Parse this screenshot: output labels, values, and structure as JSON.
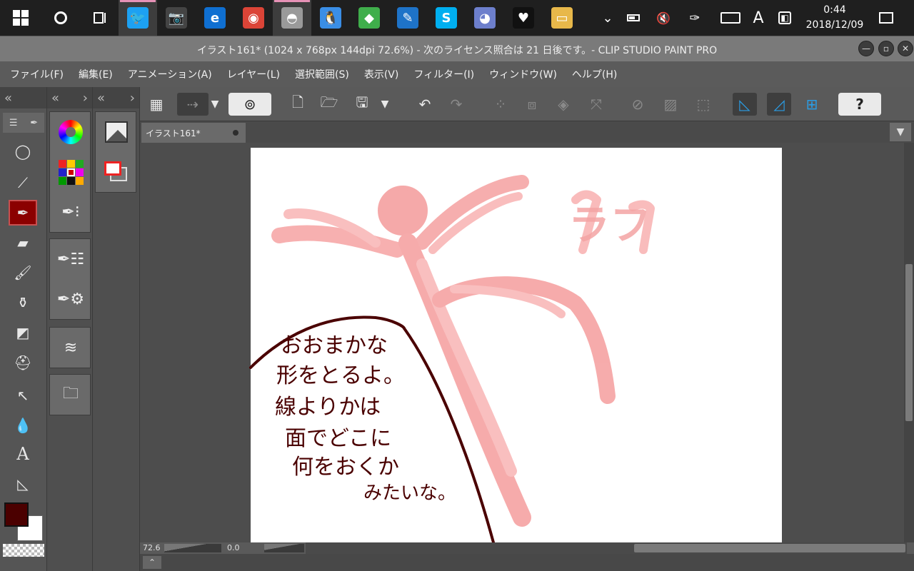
{
  "taskbar": {
    "apps": [
      {
        "name": "Twitter",
        "glyph": "🐦",
        "color": "#1da1f2",
        "pinned_active": true
      },
      {
        "name": "Camera",
        "glyph": "📷",
        "color": "#444444",
        "pinned_active": false
      },
      {
        "name": "Edge",
        "glyph": "e",
        "color": "#0f6fd1",
        "pinned_active": false
      },
      {
        "name": "Chrome",
        "glyph": "◉",
        "color": "#db4437",
        "pinned_active": false
      },
      {
        "name": "Clip Studio",
        "glyph": "◓",
        "color": "#9a9a9a",
        "pinned_active": true
      },
      {
        "name": "Pawoo",
        "glyph": "🐧",
        "color": "#3a8ee6",
        "pinned_active": false
      },
      {
        "name": "LINE Bot",
        "glyph": "◆",
        "color": "#3fae4b",
        "pinned_active": false
      },
      {
        "name": "Writer",
        "glyph": "✎",
        "color": "#1e73c8",
        "pinned_active": false
      },
      {
        "name": "Skype",
        "glyph": "S",
        "color": "#00aff0",
        "pinned_active": false
      },
      {
        "name": "Discord",
        "glyph": "◕",
        "color": "#6d7fcc",
        "pinned_active": false
      },
      {
        "name": "Heart app",
        "glyph": "♥",
        "color": "#111111",
        "pinned_active": false
      },
      {
        "name": "Explorer",
        "glyph": "▭",
        "color": "#e8b84a",
        "pinned_active": false
      }
    ],
    "tray": {
      "input_indicator": "A"
    },
    "clock": {
      "time": "0:44",
      "date": "2018/12/09"
    }
  },
  "window": {
    "title": "イラスト161* (1024 x 768px 144dpi 72.6%)  - 次のライセンス照合は 21 日後です。- CLIP STUDIO PAINT PRO"
  },
  "menu": [
    "ファイル(F)",
    "編集(E)",
    "アニメーション(A)",
    "レイヤー(L)",
    "選択範囲(S)",
    "表示(V)",
    "フィルター(I)",
    "ウィンドウ(W)",
    "ヘルプ(H)"
  ],
  "document_tab": {
    "label": "イラスト161*"
  },
  "statusbar": {
    "zoom": "72.6",
    "rotation": "0.0"
  },
  "canvas": {
    "background": "#ffffff",
    "sketch_color": "#f5a0a0",
    "ink_color": "#4a0000",
    "sketch_label": "ラフ",
    "speech_lines": [
      "おおまかな",
      "形をとるよ。",
      "線よりかは",
      "面でどこに",
      "何をおくか",
      "みたいな。"
    ]
  },
  "colors": {
    "foreground": "#4b0000",
    "background": "#ffffff"
  }
}
